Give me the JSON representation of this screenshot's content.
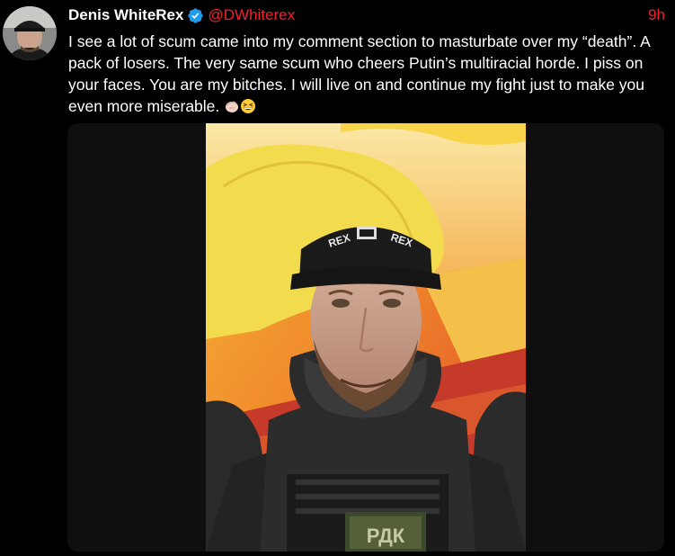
{
  "tweet": {
    "display_name": "Denis WhiteRex",
    "handle": "@DWhiterex",
    "time": "9h",
    "text": "I see a lot of scum came into my comment section to masturbate over my “death”. A pack of losers. The very same scum who cheers Putin’s multiracial horde. I piss on your faces. You are my bitches. I will live on and continue my fight just to make you even more miserable.",
    "emojis": [
      "hand-icon",
      "grinning-squinting-face-icon"
    ],
    "verified_icon": "verified-badge-icon"
  },
  "media": {
    "cap_text_left": "REX",
    "cap_text_right": "REX",
    "patch_text": "РДК"
  },
  "colors": {
    "background": "#000000",
    "text": "#ffffff",
    "handle": "#f4212e",
    "verified": "#1d9bf0"
  }
}
